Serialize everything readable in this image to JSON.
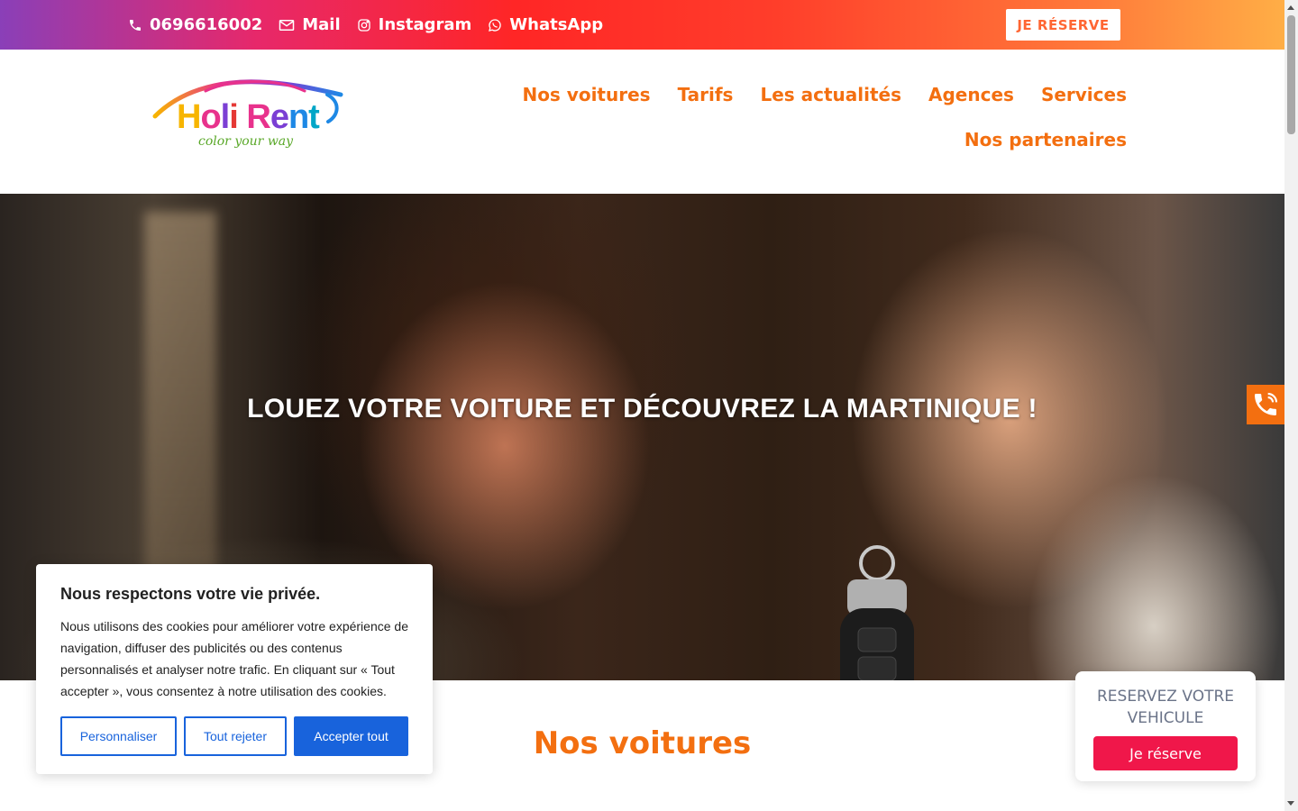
{
  "topbar": {
    "phone": "0696616002",
    "mail": "Mail",
    "instagram": "Instagram",
    "whatsapp": "WhatsApp",
    "reserve_button": "JE RÉSERVE"
  },
  "logo": {
    "name": "Holi Rent",
    "tagline": "color your way"
  },
  "nav": {
    "items": [
      {
        "label": "Nos voitures"
      },
      {
        "label": "Tarifs"
      },
      {
        "label": "Les actualités"
      },
      {
        "label": "Agences"
      },
      {
        "label": "Services"
      },
      {
        "label": "Nos partenaires"
      }
    ]
  },
  "hero": {
    "title": "LOUEZ VOTRE VOITURE ET DÉCOUVREZ LA MARTINIQUE !"
  },
  "section": {
    "title": "Nos voitures"
  },
  "reserve_widget": {
    "title": "RESERVEZ VOTRE VEHICULE",
    "button": "Je réserve"
  },
  "cookie": {
    "title": "Nous respectons votre vie privée.",
    "text": "Nous utilisons des cookies pour améliorer votre expérience de navigation, diffuser des publicités ou des contenus personnalisés et analyser notre trafic. En cliquant sur « Tout accepter », vous consentez à notre utilisation des cookies.",
    "customize": "Personnaliser",
    "reject": "Tout rejeter",
    "accept": "Accepter tout"
  },
  "colors": {
    "accent": "#f36f10",
    "cookie_blue": "#1863dc",
    "reserve_red": "#f0174a"
  },
  "icons": [
    "phone-icon",
    "mail-icon",
    "instagram-icon",
    "whatsapp-icon",
    "floating-phone-icon",
    "key-fob-image"
  ]
}
